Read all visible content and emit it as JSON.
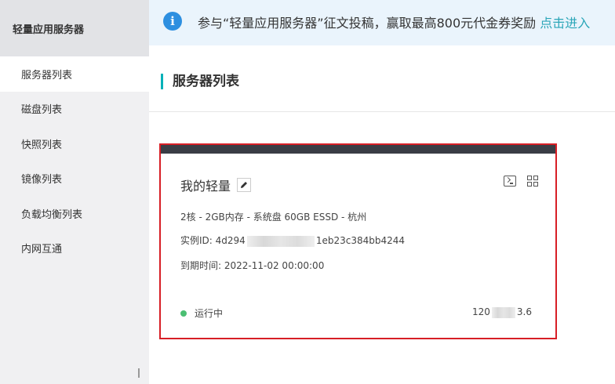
{
  "sidebar": {
    "title": "轻量应用服务器",
    "items": [
      {
        "label": "服务器列表",
        "active": true
      },
      {
        "label": "磁盘列表"
      },
      {
        "label": "快照列表"
      },
      {
        "label": "镜像列表"
      },
      {
        "label": "负载均衡列表"
      },
      {
        "label": "内网互通"
      }
    ]
  },
  "banner": {
    "icon": "info-icon",
    "text": "参与“轻量应用服务器”征文投稿，赢取最高800元代金券奖励",
    "link": "点击进入"
  },
  "page": {
    "title": "服务器列表"
  },
  "card": {
    "name": "我的轻量",
    "spec": "2核 - 2GB内存 - 系统盘 60GB ESSD - 杭州",
    "instance_id_label": "实例ID:",
    "instance_id_prefix": "4d294",
    "instance_id_suffix": "1eb23c384bb4244",
    "expire_label": "到期时间:",
    "expire_value": "2022-11-02 00:00:00",
    "status": "运行中",
    "ip_prefix": "120",
    "ip_suffix": "3.6",
    "colors": {
      "status": "#4bbf73",
      "highlight_border": "#d71f26",
      "accent": "#00b1b8"
    }
  }
}
